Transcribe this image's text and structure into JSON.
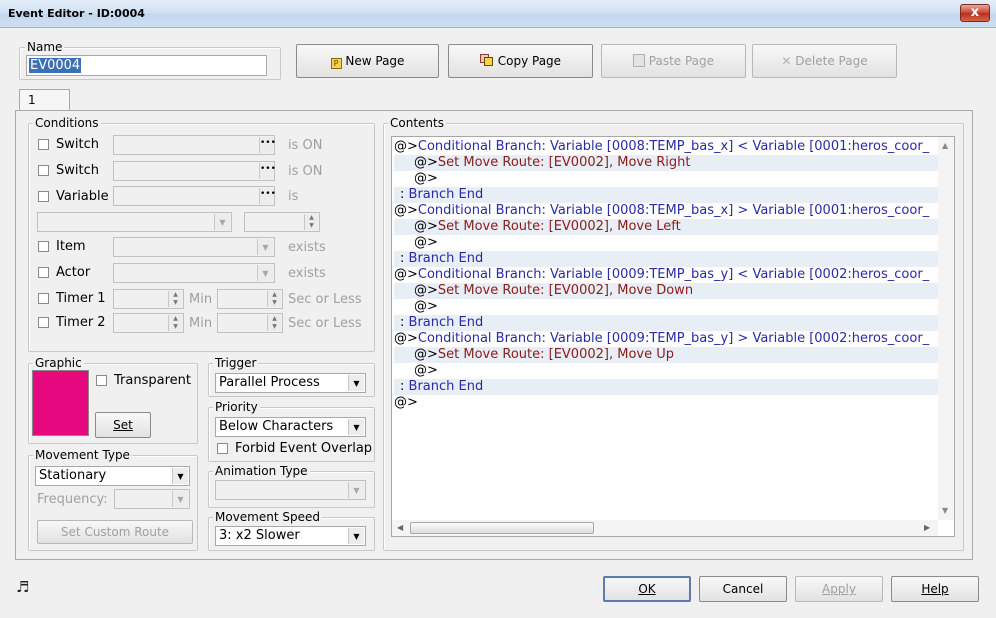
{
  "window": {
    "title": "Event Editor - ID:0004",
    "close_glyph": "x"
  },
  "name": {
    "label": "Name",
    "value": "EV0004"
  },
  "toolbar": {
    "new_page": "New Page",
    "copy_page": "Copy Page",
    "paste_page": "Paste Page",
    "delete_page": "Delete Page"
  },
  "tabs": [
    "1"
  ],
  "conditions": {
    "label": "Conditions",
    "switch1": {
      "label": "Switch",
      "suffix": "is ON"
    },
    "switch2": {
      "label": "Switch",
      "suffix": "is ON"
    },
    "variable": {
      "label": "Variable",
      "suffix": "is"
    },
    "item": {
      "label": "Item",
      "suffix": "exists"
    },
    "actor": {
      "label": "Actor",
      "suffix": "exists"
    },
    "timer1": {
      "label": "Timer 1",
      "min": "Min",
      "suffix": "Sec or Less"
    },
    "timer2": {
      "label": "Timer 2",
      "min": "Min",
      "suffix": "Sec or Less"
    }
  },
  "graphic": {
    "label": "Graphic",
    "transparent": "Transparent",
    "set": "Set",
    "swatch_color": "#e6087e"
  },
  "movement_type": {
    "label": "Movement Type",
    "value": "Stationary",
    "frequency_label": "Frequency:",
    "custom_route": "Set Custom Route"
  },
  "trigger": {
    "label": "Trigger",
    "value": "Parallel Process"
  },
  "priority": {
    "label": "Priority",
    "value": "Below Characters",
    "forbid_overlap": "Forbid Event Overlap"
  },
  "animation_type": {
    "label": "Animation Type"
  },
  "movement_speed": {
    "label": "Movement Speed",
    "value": "3: x2 Slower"
  },
  "contents": {
    "label": "Contents",
    "rows": [
      {
        "prefix": "@>",
        "text": "Conditional Branch: Variable [0008:TEMP_bas_x] < Variable [0001:heros_coor_",
        "kind": "blue",
        "indent": 0
      },
      {
        "prefix": "@>",
        "text": "Set Move Route: [EV0002], Move Right",
        "kind": "red",
        "indent": 1
      },
      {
        "prefix": "@>",
        "text": "",
        "kind": "plain",
        "indent": 1
      },
      {
        "prefix": ":",
        "text": "Branch End",
        "kind": "blue",
        "indent": 0
      },
      {
        "prefix": "@>",
        "text": "Conditional Branch: Variable [0008:TEMP_bas_x] > Variable [0001:heros_coor_",
        "kind": "blue",
        "indent": 0
      },
      {
        "prefix": "@>",
        "text": "Set Move Route: [EV0002], Move Left",
        "kind": "red",
        "indent": 1
      },
      {
        "prefix": "@>",
        "text": "",
        "kind": "plain",
        "indent": 1
      },
      {
        "prefix": ":",
        "text": "Branch End",
        "kind": "blue",
        "indent": 0
      },
      {
        "prefix": "@>",
        "text": "Conditional Branch: Variable [0009:TEMP_bas_y] < Variable [0002:heros_coor_",
        "kind": "blue",
        "indent": 0
      },
      {
        "prefix": "@>",
        "text": "Set Move Route: [EV0002], Move Down",
        "kind": "red",
        "indent": 1
      },
      {
        "prefix": "@>",
        "text": "",
        "kind": "plain",
        "indent": 1
      },
      {
        "prefix": ":",
        "text": "Branch End",
        "kind": "blue",
        "indent": 0
      },
      {
        "prefix": "@>",
        "text": "Conditional Branch: Variable [0009:TEMP_bas_y] > Variable [0002:heros_coor_",
        "kind": "blue",
        "indent": 0
      },
      {
        "prefix": "@>",
        "text": "Set Move Route: [EV0002], Move Up",
        "kind": "red",
        "indent": 1
      },
      {
        "prefix": "@>",
        "text": "",
        "kind": "plain",
        "indent": 1
      },
      {
        "prefix": ":",
        "text": "Branch End",
        "kind": "blue",
        "indent": 0
      },
      {
        "prefix": "@>",
        "text": "",
        "kind": "plain",
        "indent": 0
      }
    ]
  },
  "footer": {
    "ok": "OK",
    "cancel": "Cancel",
    "apply": "Apply",
    "help": "Help"
  },
  "icons": {
    "music": "music-note-icon"
  }
}
